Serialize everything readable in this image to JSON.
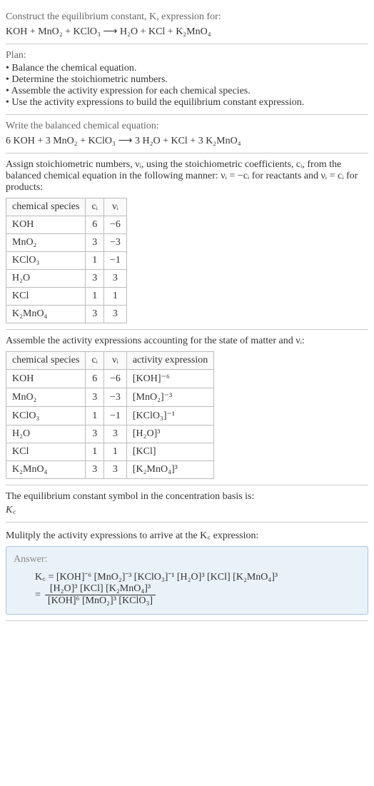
{
  "header": {
    "prompt": "Construct the equilibrium constant, K, expression for:",
    "equation": "KOH + MnO₂ + KClO₃ ⟶ H₂O + KCl + K₂MnO₄"
  },
  "plan": {
    "title": "Plan:",
    "items": [
      "• Balance the chemical equation.",
      "• Determine the stoichiometric numbers.",
      "• Assemble the activity expression for each chemical species.",
      "• Use the activity expressions to build the equilibrium constant expression."
    ]
  },
  "balanced": {
    "prompt": "Write the balanced chemical equation:",
    "equation": "6 KOH + 3 MnO₂ + KClO₃ ⟶ 3 H₂O + KCl + 3 K₂MnO₄"
  },
  "stoich": {
    "intro": "Assign stoichiometric numbers, νᵢ, using the stoichiometric coefficients, cᵢ, from the balanced chemical equation in the following manner: νᵢ = −cᵢ for reactants and νᵢ = cᵢ for products:",
    "headers": [
      "chemical species",
      "cᵢ",
      "νᵢ"
    ],
    "rows": [
      [
        "KOH",
        "6",
        "−6"
      ],
      [
        "MnO₂",
        "3",
        "−3"
      ],
      [
        "KClO₃",
        "1",
        "−1"
      ],
      [
        "H₂O",
        "3",
        "3"
      ],
      [
        "KCl",
        "1",
        "1"
      ],
      [
        "K₂MnO₄",
        "3",
        "3"
      ]
    ]
  },
  "activity": {
    "intro": "Assemble the activity expressions accounting for the state of matter and νᵢ:",
    "headers": [
      "chemical species",
      "cᵢ",
      "νᵢ",
      "activity expression"
    ],
    "rows": [
      {
        "sp": "KOH",
        "c": "6",
        "v": "−6",
        "expr": "[KOH]⁻⁶"
      },
      {
        "sp": "MnO₂",
        "c": "3",
        "v": "−3",
        "expr": "[MnO₂]⁻³"
      },
      {
        "sp": "KClO₃",
        "c": "1",
        "v": "−1",
        "expr": "[KClO₃]⁻¹"
      },
      {
        "sp": "H₂O",
        "c": "3",
        "v": "3",
        "expr": "[H₂O]³"
      },
      {
        "sp": "KCl",
        "c": "1",
        "v": "1",
        "expr": "[KCl]"
      },
      {
        "sp": "K₂MnO₄",
        "c": "3",
        "v": "3",
        "expr": "[K₂MnO₄]³"
      }
    ]
  },
  "symbol": {
    "intro": "The equilibrium constant symbol in the concentration basis is:",
    "sym": "K꜀"
  },
  "multiply": {
    "intro": "Mulitply the activity expressions to arrive at the K꜀ expression:"
  },
  "answer": {
    "label": "Answer:",
    "line1": "K꜀ = [KOH]⁻⁶ [MnO₂]⁻³ [KClO₃]⁻¹ [H₂O]³ [KCl] [K₂MnO₄]³",
    "frac_num": "[H₂O]³ [KCl] [K₂MnO₄]³",
    "frac_den": "[KOH]⁶ [MnO₂]³ [KClO₃]",
    "eq_prefix": "= "
  }
}
